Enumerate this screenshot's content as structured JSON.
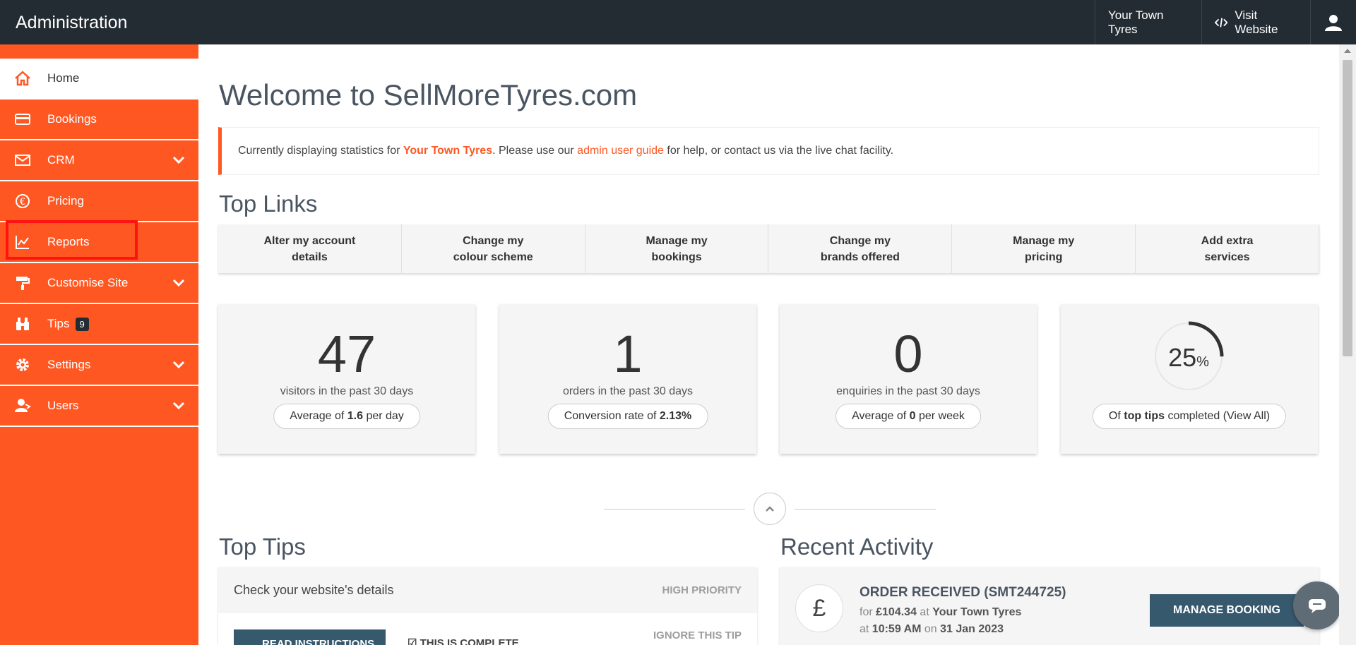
{
  "header": {
    "title": "Administration",
    "site_name": "Your Town Tyres",
    "visit_label": "Visit Website",
    "user_icon": "user-icon"
  },
  "sidebar": {
    "items": [
      {
        "label": "Home",
        "icon": "home-icon",
        "active": true
      },
      {
        "label": "Bookings",
        "icon": "credit-card-icon"
      },
      {
        "label": "CRM",
        "icon": "envelope-icon",
        "expandable": true
      },
      {
        "label": "Pricing",
        "icon": "euro-icon"
      },
      {
        "label": "Reports",
        "icon": "chart-line-icon"
      },
      {
        "label": "Customise Site",
        "icon": "paint-roller-icon",
        "expandable": true,
        "highlighted": true
      },
      {
        "label": "Tips",
        "icon": "binoculars-icon",
        "badge": "9"
      },
      {
        "label": "Settings",
        "icon": "gear-icon",
        "expandable": true
      },
      {
        "label": "Users",
        "icon": "users-icon",
        "expandable": true
      }
    ],
    "accent_color": "#ff5722"
  },
  "main": {
    "title": "Welcome to SellMoreTyres.com",
    "notice": {
      "prefix": "Currently displaying statistics for ",
      "site": "Your Town Tyres",
      "middle": ". Please use our ",
      "link": "admin user guide",
      "suffix": " for help, or contact us via the live chat facility."
    },
    "top_links_title": "Top Links",
    "top_links": [
      "Alter my account details",
      "Change my colour scheme",
      "Manage my bookings",
      "Change my brands offered",
      "Manage my pricing",
      "Add extra services"
    ],
    "stats": [
      {
        "value": "47",
        "desc": "visitors in the past 30 days",
        "pill_pre": "Average of ",
        "pill_bold": "1.6",
        "pill_post": " per day"
      },
      {
        "value": "1",
        "desc": "orders in the past 30 days",
        "pill_pre": "Conversion rate of ",
        "pill_bold": "2.13%",
        "pill_post": ""
      },
      {
        "value": "0",
        "desc": "enquiries in the past 30 days",
        "pill_pre": "Average of ",
        "pill_bold": "0",
        "pill_post": " per week"
      }
    ],
    "tips_progress": {
      "value": "25",
      "unit": "%",
      "fraction": 0.25,
      "pill_pre": "Of ",
      "pill_bold": "top tips",
      "pill_mid": " completed (",
      "pill_link": "View All",
      "pill_post": ")"
    },
    "top_tips_title": "Top Tips",
    "tip": {
      "title": "Check your website's details",
      "priority": "HIGH PRIORITY",
      "read_label": "READ INSTRUCTIONS",
      "complete_label": "THIS IS COMPLETE",
      "ignore_label": "IGNORE THIS TIP"
    },
    "recent_title": "Recent Activity",
    "activity": {
      "icon": "pound-icon",
      "symbol": "£",
      "title": "ORDER RECEIVED (SMT244725)",
      "for_label": "for ",
      "amount": "£104.34",
      "at_label": " at ",
      "site": "Your Town Tyres",
      "time_at": "at ",
      "time": "10:59 AM",
      "on_label": " on ",
      "date": "31 Jan 2023",
      "button": "MANAGE BOOKING"
    }
  }
}
